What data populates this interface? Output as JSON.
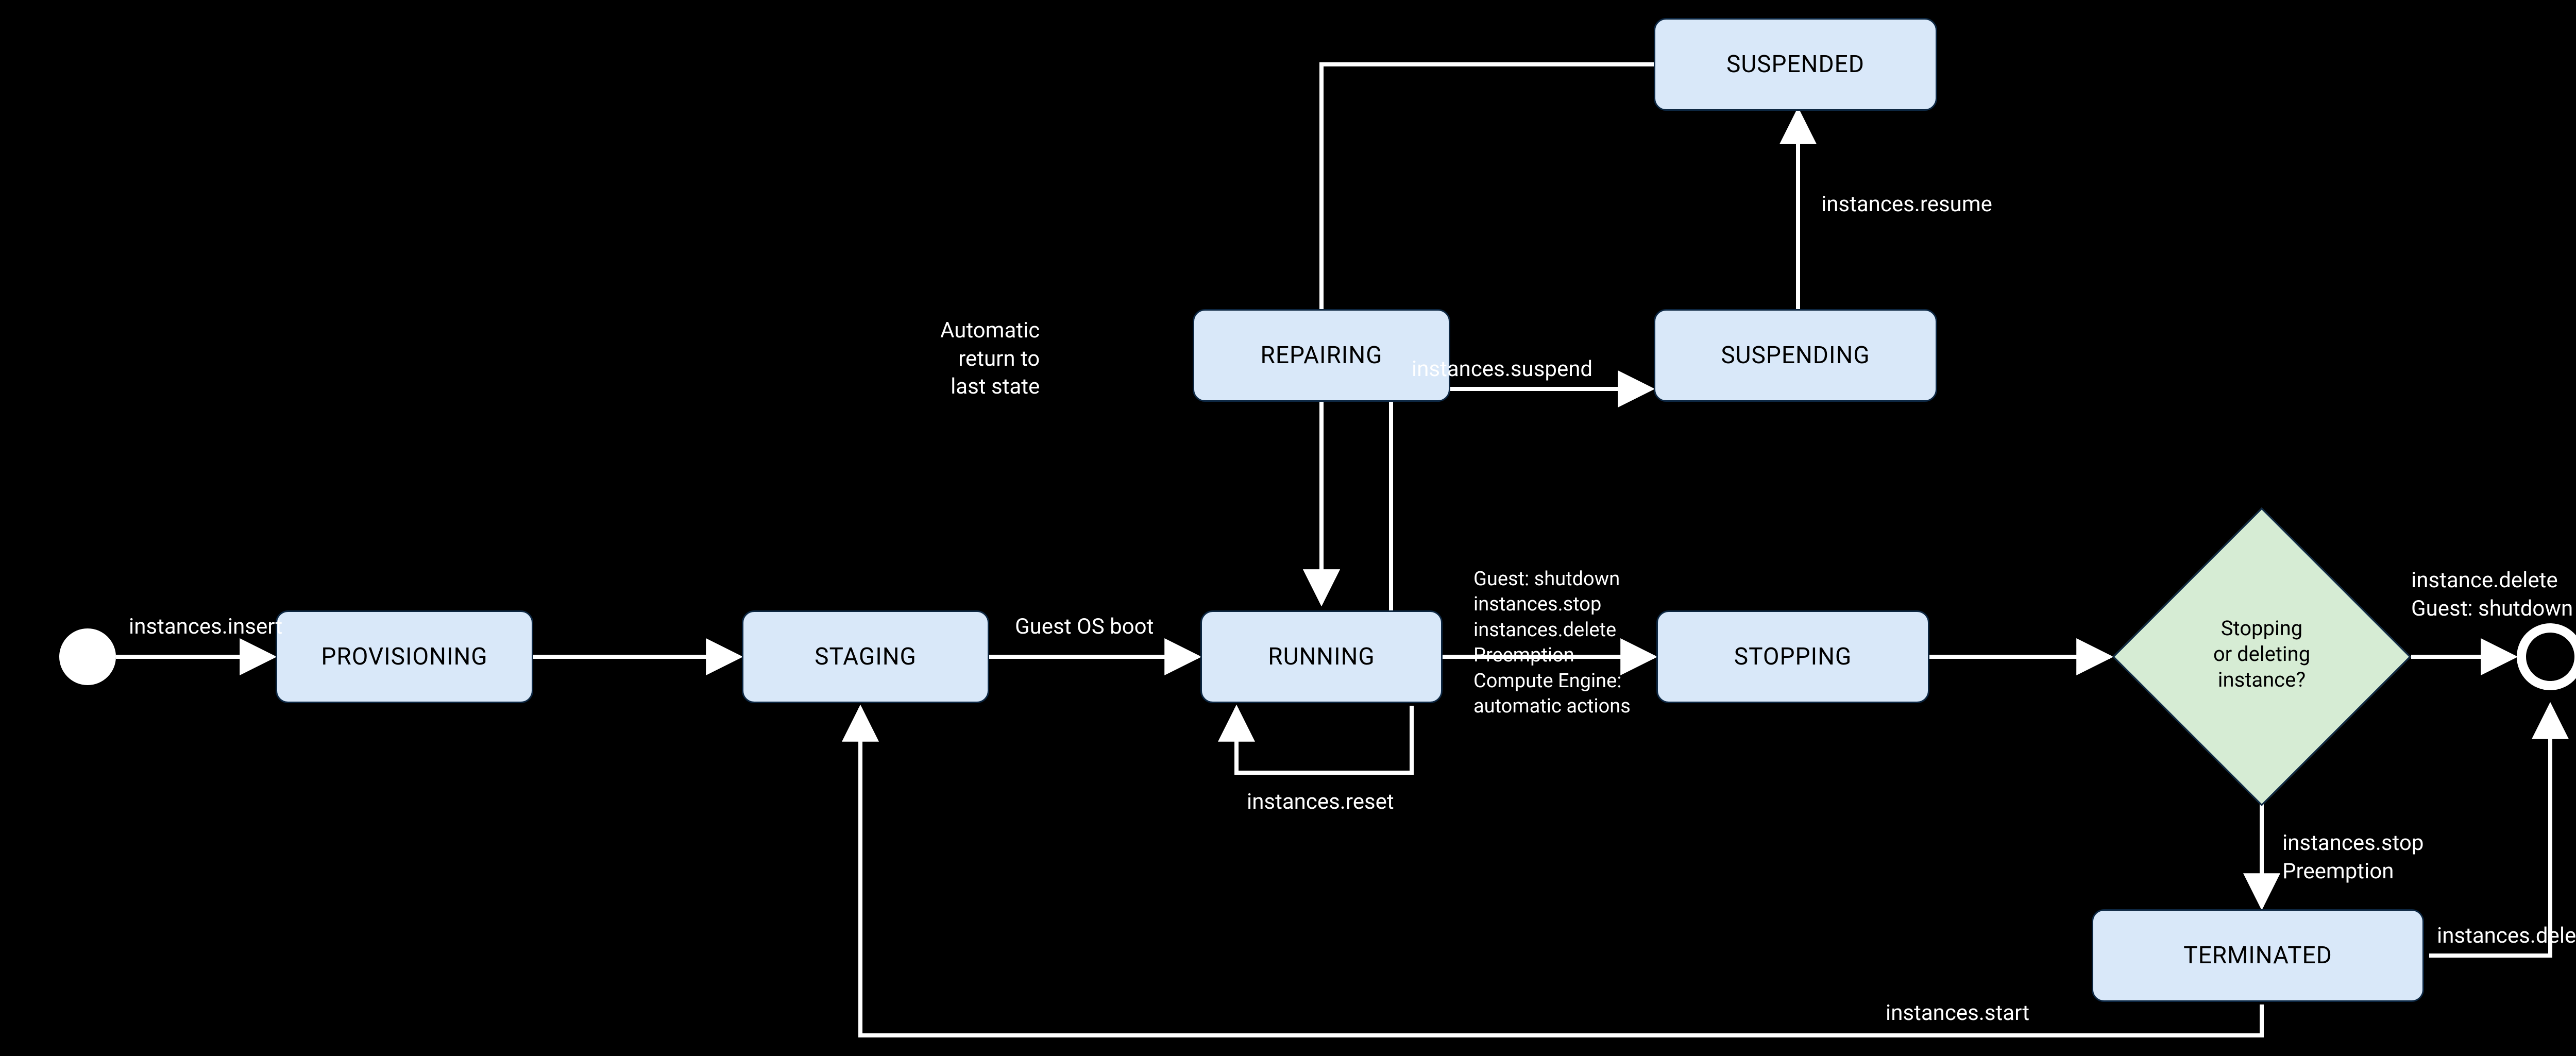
{
  "states": {
    "provisioning": "PROVISIONING",
    "staging": "STAGING",
    "repairing": "REPAIRING",
    "running": "RUNNING",
    "suspending": "SUSPENDING",
    "suspended": "SUSPENDED",
    "stopping": "STOPPING",
    "terminated": "TERMINATED"
  },
  "decision": {
    "label": "Stopping\nor deleting\ninstance?"
  },
  "edge_labels": {
    "create": "instances.insert",
    "guest_os_boot": "Guest OS boot",
    "reset": "instances.reset",
    "repairing_out": "Automatic\nreturn to\nlast state",
    "suspend": "instances.suspend",
    "resume": "instances.resume",
    "shutdown": "Guest: shutdown\ninstances.stop\ninstances.delete\nPreemption\nCompute Engine:\nautomatic actions",
    "decision_delete": "instance.delete\nGuest: shutdown",
    "decision_stop": "instances.stop\nPreemption",
    "terminated_resume": "instances.start",
    "terminated_delete": "instances.delete"
  }
}
